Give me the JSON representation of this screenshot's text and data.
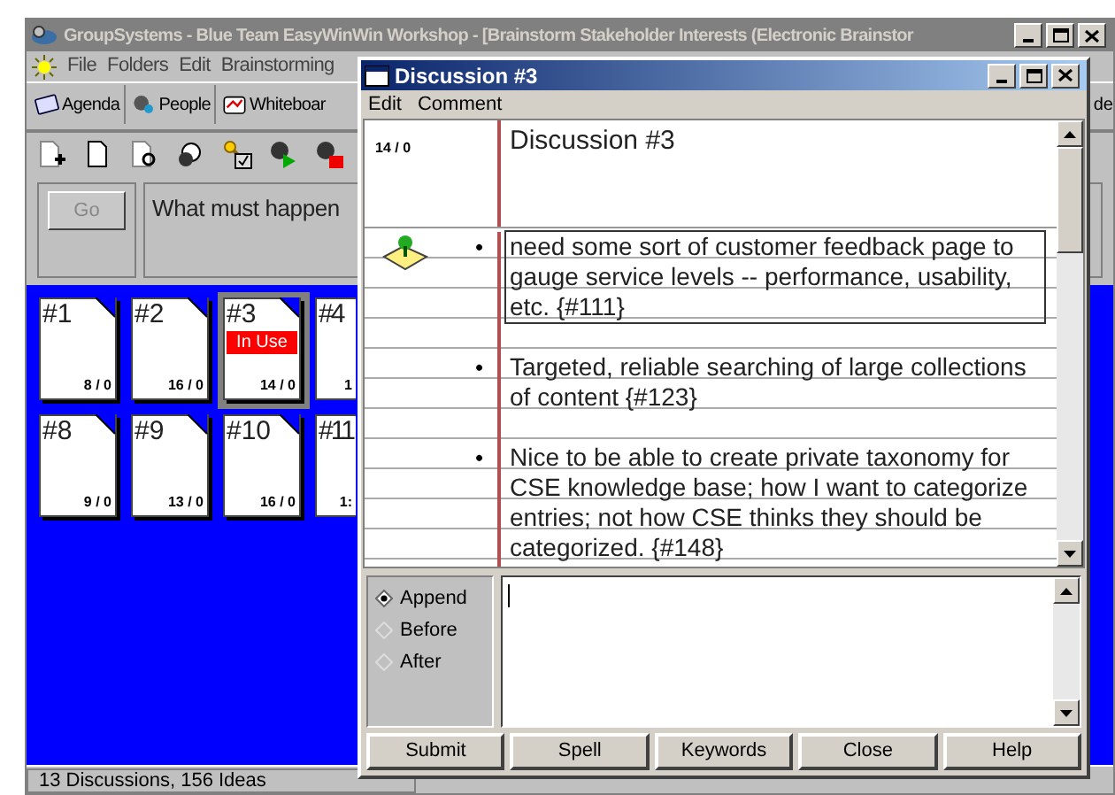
{
  "main_window": {
    "title": "GroupSystems - Blue Team EasyWinWin Workshop - [Brainstorm Stakeholder Interests (Electronic Brainstor",
    "menu": [
      "File",
      "Folders",
      "Edit",
      "Brainstorming"
    ],
    "toolbar": [
      {
        "label": "Agenda"
      },
      {
        "label": "People"
      },
      {
        "label": "Whiteboar"
      }
    ],
    "toolbar_right_label": "de",
    "go_button": "Go",
    "question": "What must happen",
    "cards": [
      {
        "label": "#1",
        "count": "8 / 0",
        "selected": false
      },
      {
        "label": "#2",
        "count": "16 / 0",
        "selected": false
      },
      {
        "label": "#3",
        "count": "14 / 0",
        "selected": true,
        "badge": "In Use"
      },
      {
        "label": "#4",
        "count": "1",
        "selected": false
      },
      {
        "label": "#8",
        "count": "9 / 0",
        "selected": false
      },
      {
        "label": "#9",
        "count": "13 / 0",
        "selected": false
      },
      {
        "label": "#10",
        "count": "16 / 0",
        "selected": false
      },
      {
        "label": "#11",
        "count": "1:",
        "selected": false
      }
    ],
    "status_bar": "13 Discussions, 156 Ideas"
  },
  "dialog": {
    "title": "Discussion #3",
    "menu": [
      "Edit",
      "Comment"
    ],
    "count": "14 / 0",
    "heading": "Discussion #3",
    "ideas": [
      {
        "bullet": "•",
        "text": "need some sort of customer feedback page to gauge service levels -- performance, usability, etc. {#111}",
        "selected": true,
        "note": true
      },
      {
        "bullet": "•",
        "text": "Targeted, reliable searching of large collections of content {#123}",
        "selected": false,
        "note": false
      },
      {
        "bullet": "•",
        "text": "Nice to be able to create private taxonomy for CSE knowledge base; how I want to categorize entries; not how CSE thinks they should be categorized. {#148}",
        "selected": false,
        "note": false
      }
    ],
    "positions": [
      {
        "label": "Append",
        "selected": true
      },
      {
        "label": "Before",
        "selected": false
      },
      {
        "label": "After",
        "selected": false
      }
    ],
    "buttons": [
      "Submit",
      "Spell",
      "Keywords",
      "Close",
      "Help"
    ]
  }
}
